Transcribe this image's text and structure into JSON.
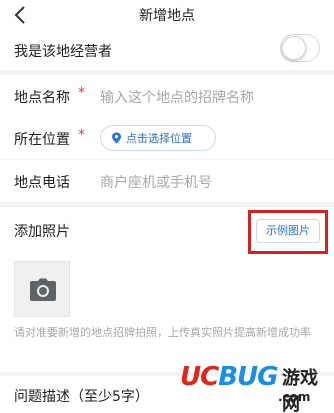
{
  "header": {
    "title": "新增地点",
    "back_icon": "chevron-left-icon"
  },
  "owner": {
    "label": "我是该地经营者",
    "toggle_on": false
  },
  "fields": {
    "name": {
      "label": "地点名称",
      "required_mark": "*",
      "placeholder": "输入这个地点的招牌名称"
    },
    "location": {
      "label": "所在位置",
      "required_mark": "*",
      "button_label": "点击选择位置",
      "icon": "location-pin-icon"
    },
    "phone": {
      "label": "地点电话",
      "placeholder": "商户座机或手机号"
    }
  },
  "photos": {
    "label": "添加照片",
    "example_button": "示例图片",
    "camera_icon": "camera-icon",
    "tip": "请对准要新增的地点招牌拍照，上传真实照片提高新增成功率"
  },
  "description": {
    "label": "问题描述（至少5字）"
  },
  "watermark": {
    "logo_uc": "UC",
    "logo_bug": "BUG",
    "logo_cn": "游戏网",
    "domain": ".com"
  },
  "colors": {
    "accent_blue": "#2f6fdc",
    "required_red": "#e43a3a",
    "highlight_red": "#d32222",
    "placeholder_gray": "#a8a8a8"
  }
}
